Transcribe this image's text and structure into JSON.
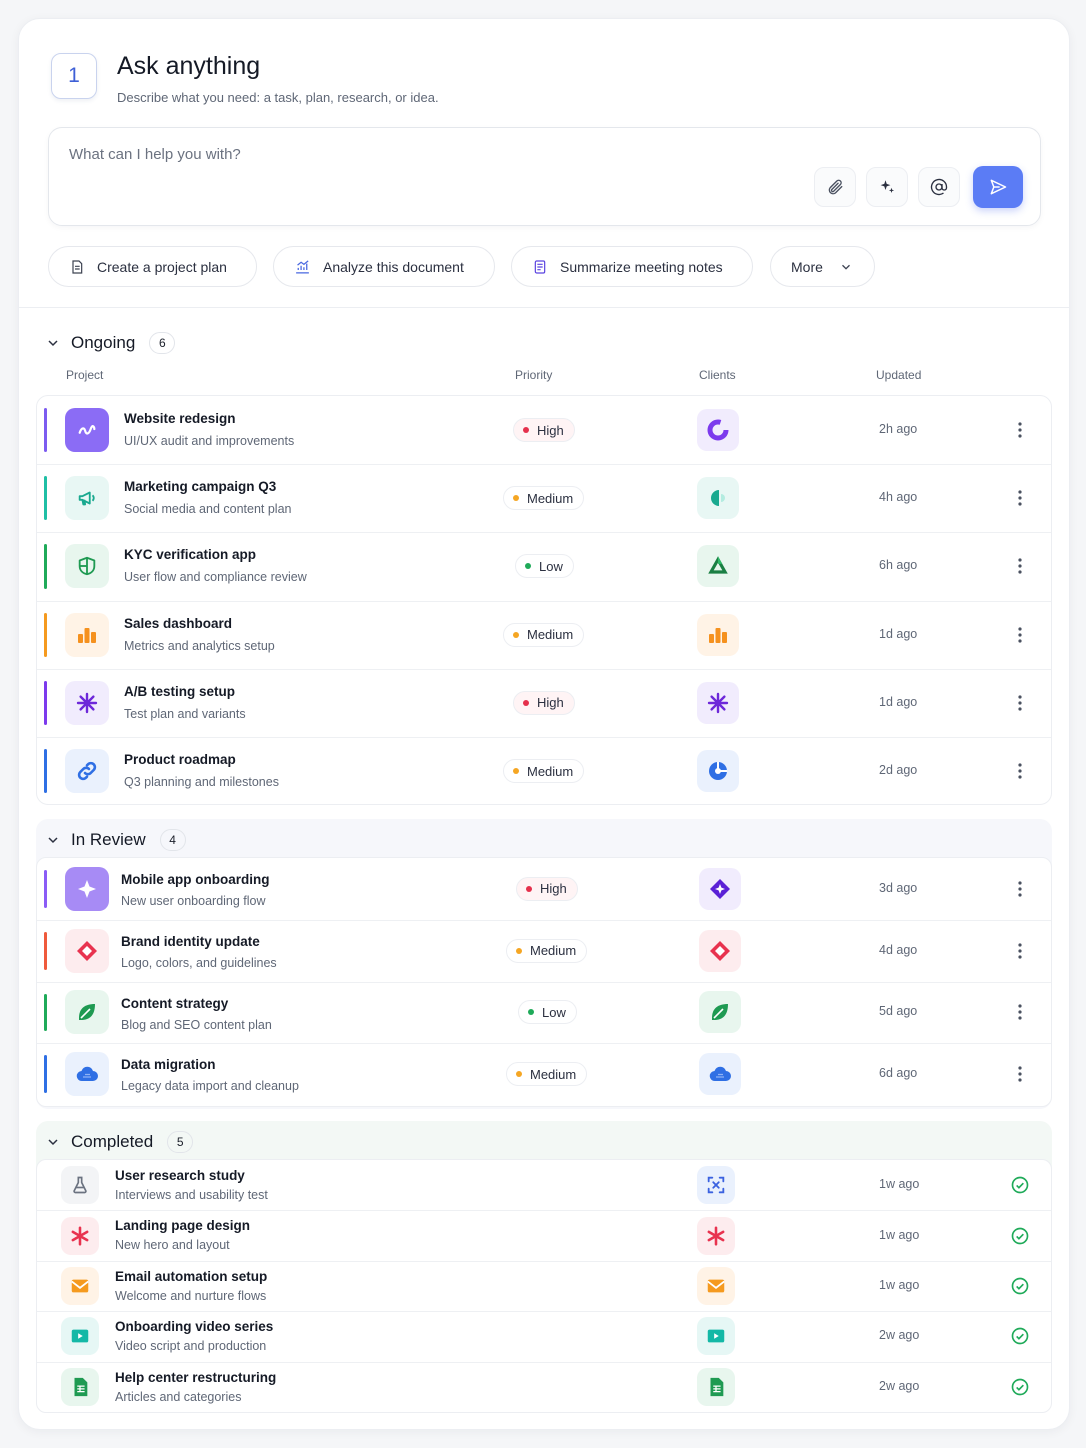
{
  "header": {
    "step": "1",
    "title": "Ask anything",
    "subtitle": "Describe what you need: a task, plan, research, or idea."
  },
  "prompt": {
    "placeholder": "What can I help you with?"
  },
  "chips": [
    {
      "label": "Create a project plan",
      "icon": "document-icon"
    },
    {
      "label": "Analyze this document",
      "icon": "chart-icon"
    },
    {
      "label": "Summarize meeting notes",
      "icon": "notes-icon"
    },
    {
      "label": "More",
      "icon": "chevron-down-icon"
    }
  ],
  "columns": {
    "project": "Project",
    "priority": "Priority",
    "clients": "Clients",
    "updated": "Updated"
  },
  "colors": {
    "accent": "#5b7cf5",
    "high": "#e5304c",
    "medium": "#f5a623",
    "low": "#1faa59"
  },
  "sections": {
    "ongoing": {
      "title": "Ongoing",
      "count": "6",
      "rows": [
        {
          "name": "Website redesign",
          "desc": "UI/UX audit and improvements",
          "priority": "High",
          "updated": "2h ago",
          "color": "#7c5cf0"
        },
        {
          "name": "Marketing campaign Q3",
          "desc": "Social media and content plan",
          "priority": "Medium",
          "updated": "4h ago",
          "color": "#1fbfa5"
        },
        {
          "name": "KYC verification app",
          "desc": "User flow and compliance review",
          "priority": "Low",
          "updated": "6h ago",
          "color": "#1faa59"
        },
        {
          "name": "Sales dashboard",
          "desc": "Metrics and analytics setup",
          "priority": "Medium",
          "updated": "1d ago",
          "color": "#f59a1f"
        },
        {
          "name": "A/B testing setup",
          "desc": "Test plan and variants",
          "priority": "High",
          "updated": "1d ago",
          "color": "#7c3aed"
        },
        {
          "name": "Product roadmap",
          "desc": "Q3 planning and milestones",
          "priority": "Medium",
          "updated": "2d ago",
          "color": "#2f6fe4"
        }
      ]
    },
    "review": {
      "title": "In Review",
      "count": "4",
      "rows": [
        {
          "name": "Mobile app onboarding",
          "desc": "New user onboarding flow",
          "priority": "High",
          "updated": "3d ago",
          "color": "#8b5cf6"
        },
        {
          "name": "Brand identity update",
          "desc": "Logo, colors, and guidelines",
          "priority": "Medium",
          "updated": "4d ago",
          "color": "#ef5a3c"
        },
        {
          "name": "Content strategy",
          "desc": "Blog and SEO content plan",
          "priority": "Low",
          "updated": "5d ago",
          "color": "#1faa59"
        },
        {
          "name": "Data migration",
          "desc": "Legacy data import and cleanup",
          "priority": "Medium",
          "updated": "6d ago",
          "color": "#2f6fe4"
        }
      ]
    },
    "completed": {
      "title": "Completed",
      "count": "5",
      "rows": [
        {
          "name": "User research study",
          "desc": "Interviews and usability test",
          "updated": "1w ago"
        },
        {
          "name": "Landing page design",
          "desc": "New hero and layout",
          "updated": "1w ago"
        },
        {
          "name": "Email automation setup",
          "desc": "Welcome and nurture flows",
          "updated": "1w ago"
        },
        {
          "name": "Onboarding video series",
          "desc": "Video script and production",
          "updated": "2w ago"
        },
        {
          "name": "Help center restructuring",
          "desc": "Articles and categories",
          "updated": "2w ago"
        }
      ]
    }
  }
}
